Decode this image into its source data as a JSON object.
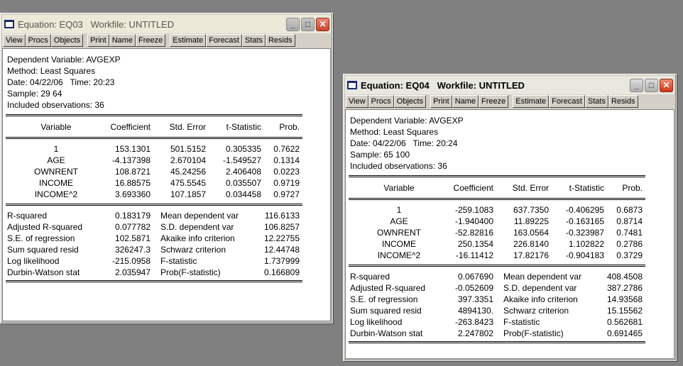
{
  "toolbar": {
    "view": "View",
    "procs": "Procs",
    "objects": "Objects",
    "print": "Print",
    "name": "Name",
    "freeze": "Freeze",
    "estimate": "Estimate",
    "forecast": "Forecast",
    "stats": "Stats",
    "resids": "Resids"
  },
  "eq03": {
    "title": "Equation: EQ03   Workfile: UNTITLED",
    "header": [
      "Dependent Variable: AVGEXP",
      "Method: Least Squares",
      "Date: 04/22/06   Time: 20:23",
      "Sample: 29 64",
      "Included observations: 36"
    ],
    "columns": [
      "Variable",
      "Coefficient",
      "Std. Error",
      "t-Statistic",
      "Prob."
    ],
    "rows": [
      [
        "1",
        "153.1301",
        "501.5152",
        "0.305335",
        "0.7622"
      ],
      [
        "AGE",
        "-4.137398",
        "2.670104",
        "-1.549527",
        "0.1314"
      ],
      [
        "OWNRENT",
        "108.8721",
        "45.24256",
        "2.406408",
        "0.0223"
      ],
      [
        "INCOME",
        "16.88575",
        "475.5545",
        "0.035507",
        "0.9719"
      ],
      [
        "INCOME^2",
        "3.693360",
        "107.1857",
        "0.034458",
        "0.9727"
      ]
    ],
    "stats": [
      [
        "R-squared",
        "0.183179",
        "Mean dependent var",
        "116.6133"
      ],
      [
        "Adjusted R-squared",
        "0.077782",
        "S.D. dependent var",
        "106.8257"
      ],
      [
        "S.E. of regression",
        "102.5871",
        "Akaike info criterion",
        "12.22755"
      ],
      [
        "Sum squared resid",
        "326247.3",
        "Schwarz criterion",
        "12.44748"
      ],
      [
        "Log likelihood",
        "-215.0958",
        "F-statistic",
        "1.737999"
      ],
      [
        "Durbin-Watson stat",
        "2.035947",
        "Prob(F-statistic)",
        "0.166809"
      ]
    ]
  },
  "eq04": {
    "title": "Equation: EQ04   Workfile: UNTITLED",
    "header": [
      "Dependent Variable: AVGEXP",
      "Method: Least Squares",
      "Date: 04/22/06   Time: 20:24",
      "Sample: 65 100",
      "Included observations: 36"
    ],
    "columns": [
      "Variable",
      "Coefficient",
      "Std. Error",
      "t-Statistic",
      "Prob."
    ],
    "rows": [
      [
        "1",
        "-259.1083",
        "637.7350",
        "-0.406295",
        "0.6873"
      ],
      [
        "AGE",
        "-1.940400",
        "11.89225",
        "-0.163165",
        "0.8714"
      ],
      [
        "OWNRENT",
        "-52.82816",
        "163.0564",
        "-0.323987",
        "0.7481"
      ],
      [
        "INCOME",
        "250.1354",
        "226.8140",
        "1.102822",
        "0.2786"
      ],
      [
        "INCOME^2",
        "-16.11412",
        "17.82176",
        "-0.904183",
        "0.3729"
      ]
    ],
    "stats": [
      [
        "R-squared",
        "0.067690",
        "Mean dependent var",
        "408.4508"
      ],
      [
        "Adjusted R-squared",
        "-0.052609",
        "S.D. dependent var",
        "387.2786"
      ],
      [
        "S.E. of regression",
        "397.3351",
        "Akaike info criterion",
        "14.93568"
      ],
      [
        "Sum squared resid",
        "4894130.",
        "Schwarz criterion",
        "15.15562"
      ],
      [
        "Log likelihood",
        "-263.8423",
        "F-statistic",
        "0.562681"
      ],
      [
        "Durbin-Watson stat",
        "2.247802",
        "Prob(F-statistic)",
        "0.691465"
      ]
    ]
  }
}
